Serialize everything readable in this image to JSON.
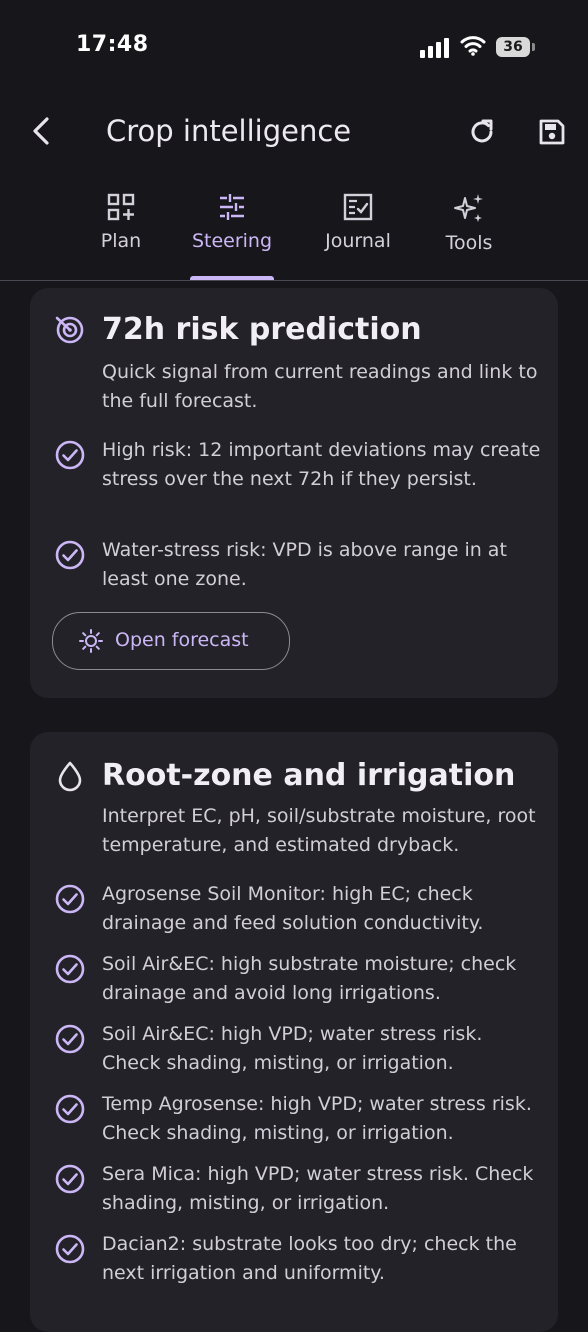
{
  "status_bar": {
    "time": "17:48",
    "battery": "36"
  },
  "header": {
    "title": "Crop intelligence"
  },
  "tabs": [
    {
      "label": "Plan",
      "icon": "grid-plus-icon"
    },
    {
      "label": "Steering",
      "icon": "sliders-icon",
      "active": true
    },
    {
      "label": "Journal",
      "icon": "journal-check-icon"
    },
    {
      "label": "Tools",
      "icon": "sparkles-icon"
    }
  ],
  "risk_card": {
    "title": "72h risk prediction",
    "subtitle": "Quick signal from current readings and link to the full forecast.",
    "items": [
      "High risk: 12 important deviations may create stress over the next 72h if they persist.",
      "Water-stress risk: VPD is above range in at least one zone."
    ],
    "button_label": "Open forecast"
  },
  "root_card": {
    "title": "Root-zone and irrigation",
    "subtitle": "Interpret EC, pH, soil/substrate moisture, root temperature, and estimated dryback.",
    "items": [
      "Agrosense Soil Monitor: high EC; check drainage and feed solution conductivity.",
      "Soil Air&EC: high substrate moisture; check drainage and avoid long irrigations.",
      "Soil Air&EC: high VPD; water stress risk. Check shading, misting, or irrigation.",
      "Temp Agrosense: high VPD; water stress risk. Check shading, misting, or irrigation.",
      "Sera Mica: high VPD; water stress risk. Check shading, misting, or irrigation.",
      "Dacian2: substrate looks too dry; check the next irrigation and uniformity."
    ]
  },
  "colors": {
    "accent": "#cbb7f6",
    "background": "#17161b",
    "card": "#232228"
  }
}
